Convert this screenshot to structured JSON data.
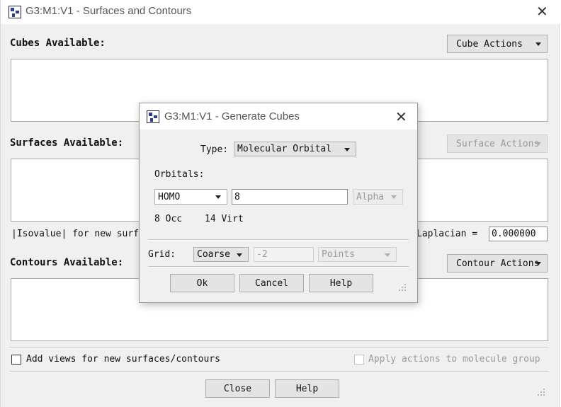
{
  "main": {
    "title": "G3:M1:V1 - Surfaces and Contours",
    "cubes_label": "Cubes Available:",
    "cube_actions": "Cube Actions",
    "surfaces_label": "Surfaces Available:",
    "surface_actions": "Surface Actions",
    "isovalue_label": "|Isovalue| for new surf",
    "laplacian_label": "Laplacian =",
    "isovalue": "0.000000",
    "contours_label": "Contours Available:",
    "contour_actions": "Contour Actions",
    "add_views_label": "Add views for new surfaces/contours",
    "apply_actions_label": "Apply actions to molecule group",
    "close_button": "Close",
    "help_button": "Help"
  },
  "dialog": {
    "title": "G3:M1:V1 - Generate Cubes",
    "type_label": "Type:",
    "type_value": "Molecular Orbital",
    "orbitals_label": "Orbitals:",
    "orbital_value": "HOMO",
    "orbital_number": "8",
    "spin_value": "Alpha",
    "occ_text": "8 Occ",
    "virt_text": "14 Virt",
    "grid_label": "Grid:",
    "grid_value": "Coarse",
    "grid_number": "-2",
    "grid_units": "Points",
    "ok_button": "Ok",
    "cancel_button": "Cancel",
    "help_button": "Help"
  },
  "icons": [
    "app-icon",
    "close-icon",
    "dropdown-arrow-icon",
    "resize-grip-icon"
  ]
}
